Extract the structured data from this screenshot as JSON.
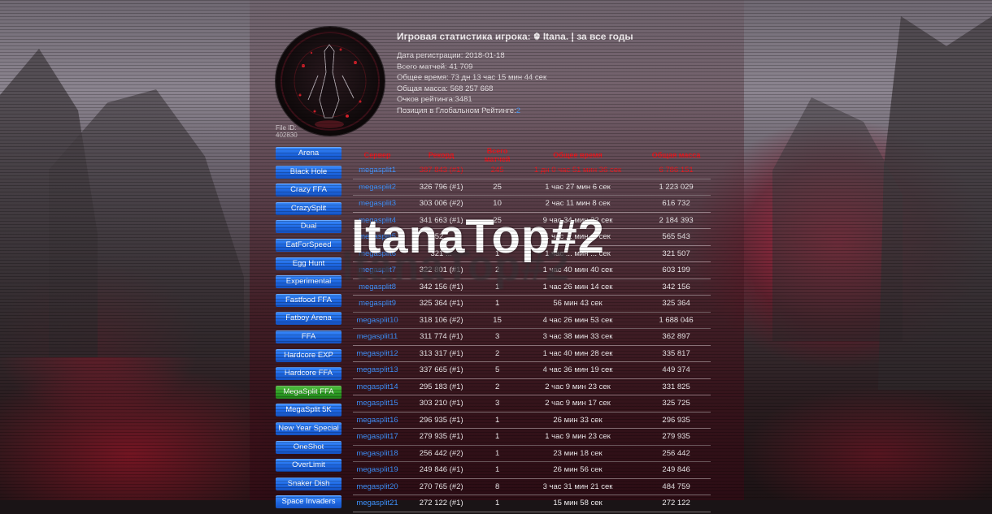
{
  "profile": {
    "title": "Игровая статистика игрока: ☬ Itana. | за все годы",
    "registration": "Дата регистрации: 2018-01-18",
    "total_matches": "Всего матчей: 41 709",
    "total_time": "Общее время: 73 дн 13 час 15 мин 44 сек",
    "total_mass": "Общая масса: 568 257 668",
    "rating_points": "Очков рейтинга:3481",
    "global_rank_label": "Позиция в Глобальном Рейтинге:",
    "global_rank_value": "2",
    "file_id_label": "File ID:",
    "file_id_value": "402830"
  },
  "watermark": {
    "text": "ItanaTop#2",
    "shadow_text": "ItanaTop#2"
  },
  "modes": [
    {
      "label": "Arena",
      "active": false
    },
    {
      "label": "Black Hole",
      "active": false
    },
    {
      "label": "Crazy FFA",
      "active": false
    },
    {
      "label": "CrazySplit",
      "active": false
    },
    {
      "label": "Dual",
      "active": false
    },
    {
      "label": "EatForSpeed",
      "active": false
    },
    {
      "label": "Egg Hunt",
      "active": false
    },
    {
      "label": "Experimental",
      "active": false
    },
    {
      "label": "Fastfood FFA",
      "active": false
    },
    {
      "label": "Fatboy Arena",
      "active": false
    },
    {
      "label": "FFA",
      "active": false
    },
    {
      "label": "Hardcore EXP",
      "active": false
    },
    {
      "label": "Hardcore FFA",
      "active": false
    },
    {
      "label": "MegaSplit FFA",
      "active": true
    },
    {
      "label": "MegaSplit 5K",
      "active": false
    },
    {
      "label": "New Year Special",
      "active": false
    },
    {
      "label": "OneShot",
      "active": false
    },
    {
      "label": "OverLimit",
      "active": false
    },
    {
      "label": "Snaker Dish",
      "active": false
    },
    {
      "label": "Space Invaders",
      "active": false
    }
  ],
  "table": {
    "headers": [
      "Сервер",
      "Рекорд",
      "Всего матчей",
      "Общее время",
      "Общая масса"
    ],
    "rows": [
      {
        "server": "megasplit1",
        "record": "387 843 (#1)",
        "matches": "245",
        "time": "1 дн 0 час 51 мин 36 сек",
        "mass": "6 786 151",
        "highlight": true
      },
      {
        "server": "megasplit2",
        "record": "326 796 (#1)",
        "matches": "25",
        "time": "1 час 27 мин 6 сек",
        "mass": "1 223 029",
        "highlight": false
      },
      {
        "server": "megasplit3",
        "record": "303 006 (#2)",
        "matches": "10",
        "time": "2 час 11 мин 8 сек",
        "mass": "616 732",
        "highlight": false
      },
      {
        "server": "megasplit4",
        "record": "341 663 (#1)",
        "matches": "25",
        "time": "9 час 34 мин 32 сек",
        "mass": "2 184 393",
        "highlight": false
      },
      {
        "server": "megasplit5",
        "record": "352 ...",
        "matches": "2",
        "time": "1 час ... мин ... сек",
        "mass": "565 543",
        "highlight": false
      },
      {
        "server": "megasplit6",
        "record": "321 ...",
        "matches": "1",
        "time": "1 час ... мин ... сек",
        "mass": "321 507",
        "highlight": false
      },
      {
        "server": "megasplit7",
        "record": "322 801 (#1)",
        "matches": "2",
        "time": "1 час 40 мин 40 сек",
        "mass": "603 199",
        "highlight": false
      },
      {
        "server": "megasplit8",
        "record": "342 156 (#1)",
        "matches": "1",
        "time": "1 час 26 мин 14 сек",
        "mass": "342 156",
        "highlight": false
      },
      {
        "server": "megasplit9",
        "record": "325 364 (#1)",
        "matches": "1",
        "time": "56 мин 43 сек",
        "mass": "325 364",
        "highlight": false
      },
      {
        "server": "megasplit10",
        "record": "318 106 (#2)",
        "matches": "15",
        "time": "4 час 26 мин 53 сек",
        "mass": "1 688 046",
        "highlight": false
      },
      {
        "server": "megasplit11",
        "record": "311 774 (#1)",
        "matches": "3",
        "time": "3 час 38 мин 33 сек",
        "mass": "362 897",
        "highlight": false
      },
      {
        "server": "megasplit12",
        "record": "313 317 (#1)",
        "matches": "2",
        "time": "1 час 40 мин 28 сек",
        "mass": "335 817",
        "highlight": false
      },
      {
        "server": "megasplit13",
        "record": "337 665 (#1)",
        "matches": "5",
        "time": "4 час 36 мин 19 сек",
        "mass": "449 374",
        "highlight": false
      },
      {
        "server": "megasplit14",
        "record": "295 183 (#1)",
        "matches": "2",
        "time": "2 час 9 мин 23 сек",
        "mass": "331 825",
        "highlight": false
      },
      {
        "server": "megasplit15",
        "record": "303 210 (#1)",
        "matches": "3",
        "time": "2 час 9 мин 17 сек",
        "mass": "325 725",
        "highlight": false
      },
      {
        "server": "megasplit16",
        "record": "296 935 (#1)",
        "matches": "1",
        "time": "26 мин 33 сек",
        "mass": "296 935",
        "highlight": false
      },
      {
        "server": "megasplit17",
        "record": "279 935 (#1)",
        "matches": "1",
        "time": "1 час 9 мин 23 сек",
        "mass": "279 935",
        "highlight": false
      },
      {
        "server": "megasplit18",
        "record": "256 442 (#2)",
        "matches": "1",
        "time": "23 мин 18 сек",
        "mass": "256 442",
        "highlight": false
      },
      {
        "server": "megasplit19",
        "record": "249 846 (#1)",
        "matches": "1",
        "time": "26 мин 56 сек",
        "mass": "249 846",
        "highlight": false
      },
      {
        "server": "megasplit20",
        "record": "270 765 (#2)",
        "matches": "8",
        "time": "3 час 31 мин 21 сек",
        "mass": "484 759",
        "highlight": false
      },
      {
        "server": "megasplit21",
        "record": "272 122 (#1)",
        "matches": "1",
        "time": "15 мин 58 сек",
        "mass": "272 122",
        "highlight": false
      }
    ]
  },
  "colors": {
    "header_red": "#e8171e",
    "link_blue": "#3f93ff",
    "button_blue": "#1d66e0",
    "button_green": "#2e9d25"
  }
}
